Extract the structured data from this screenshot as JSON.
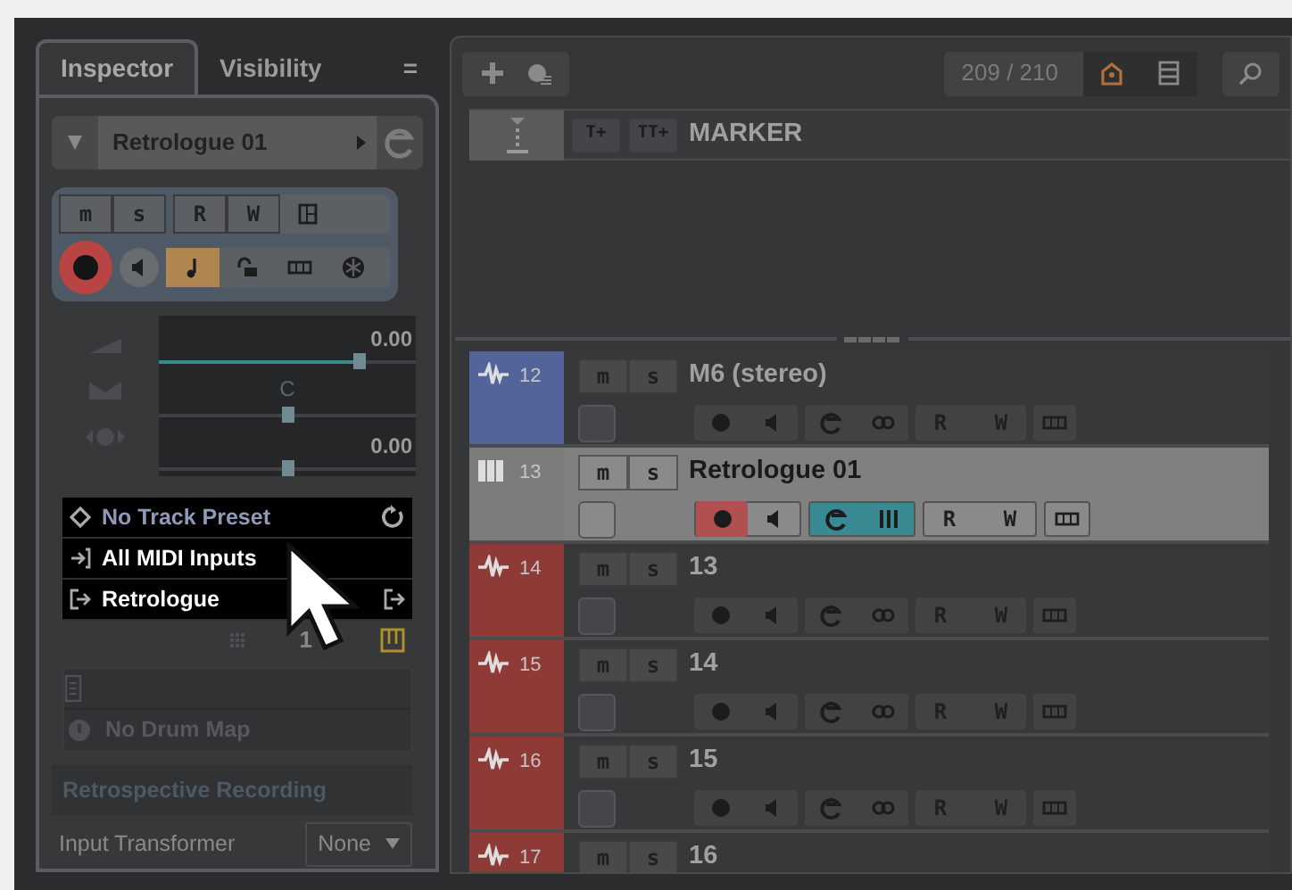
{
  "inspector": {
    "tabs": [
      {
        "label": "Inspector",
        "selected": true
      },
      {
        "label": "Visibility",
        "selected": false
      }
    ],
    "menu_glyph": "=",
    "track_name": "Retrologue 01",
    "record": true,
    "musical_time": true,
    "buttons": {
      "mute": "m",
      "solo": "s",
      "read": "R",
      "write": "W"
    },
    "volume": {
      "reading": "0.00",
      "level": 0.78
    },
    "pan": {
      "label": "C",
      "level": 0.5
    },
    "delay": {
      "reading": "0.00",
      "level": 0.5
    },
    "routing": [
      {
        "kind": "preset",
        "text": "No Track Preset"
      },
      {
        "kind": "input",
        "text": "All MIDI Inputs"
      },
      {
        "kind": "output",
        "text": "Retrologue"
      }
    ],
    "channel": "1",
    "drum_map": "No Drum Map",
    "retrospective": "Retrospective Recording",
    "input_transformer": {
      "label": "Input Transformer",
      "value": "None"
    }
  },
  "project": {
    "counter": "209 / 210",
    "marker": "MARKER",
    "marker_buttons": [
      "T+",
      "TT+"
    ],
    "tracks": [
      {
        "number": "12",
        "name": "M6 (stereo)",
        "kind": "audio",
        "color": "#52649a",
        "selected": false,
        "record": false,
        "buttons": {
          "mute": "m",
          "solo": "s",
          "read": "R",
          "write": "W"
        }
      },
      {
        "number": "13",
        "name": "Retrologue 01",
        "kind": "instrument",
        "color": "#7c7c7c",
        "selected": true,
        "record": true,
        "buttons": {
          "mute": "m",
          "solo": "s",
          "read": "R",
          "write": "W"
        }
      },
      {
        "number": "14",
        "name": "13",
        "kind": "audio",
        "color": "#8e3b38",
        "selected": false,
        "record": false,
        "buttons": {
          "mute": "m",
          "solo": "s",
          "read": "R",
          "write": "W"
        }
      },
      {
        "number": "15",
        "name": "14",
        "kind": "audio",
        "color": "#8e3b38",
        "selected": false,
        "record": false,
        "buttons": {
          "mute": "m",
          "solo": "s",
          "read": "R",
          "write": "W"
        }
      },
      {
        "number": "16",
        "name": "15",
        "kind": "audio",
        "color": "#8e3b38",
        "selected": false,
        "record": false,
        "buttons": {
          "mute": "m",
          "solo": "s",
          "read": "R",
          "write": "W"
        }
      },
      {
        "number": "17",
        "name": "16",
        "kind": "audio",
        "color": "#8e3b38",
        "selected": false,
        "buttons": {
          "mute": "m",
          "solo": "s"
        }
      }
    ]
  }
}
